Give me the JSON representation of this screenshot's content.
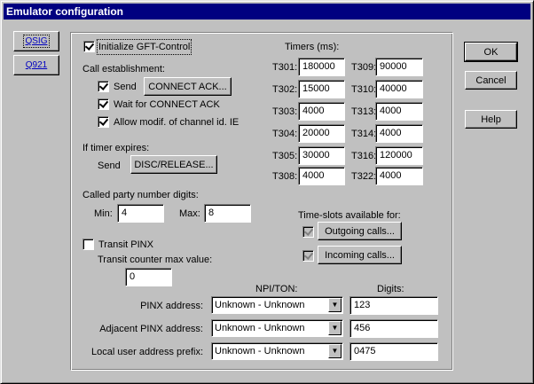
{
  "window": {
    "title": "Emulator configuration"
  },
  "tabs": [
    {
      "label": "QSIG"
    },
    {
      "label": "Q921"
    }
  ],
  "dialog_buttons": {
    "ok": "OK",
    "cancel": "Cancel",
    "help": "Help"
  },
  "init": {
    "label": "Initialize GFT-Control",
    "checked": true
  },
  "call_establishment": {
    "heading": "Call establishment:",
    "send_label": "Send",
    "send_checked": true,
    "connect_ack_button": "CONNECT ACK...",
    "wait_label": "Wait for CONNECT ACK",
    "wait_checked": true,
    "allow_label": "Allow modif. of channel id. IE",
    "allow_checked": true
  },
  "timer_expire": {
    "heading": "If timer expires:",
    "send_label": "Send",
    "disc_button": "DISC/RELEASE..."
  },
  "called_party": {
    "heading": "Called party number digits:",
    "min_label": "Min:",
    "min_value": "4",
    "max_label": "Max:",
    "max_value": "8"
  },
  "transit": {
    "label": "Transit PINX",
    "checked": false,
    "counter_label": "Transit counter max value:",
    "counter_value": "0"
  },
  "timers": {
    "heading": "Timers (ms):",
    "left": [
      {
        "name": "T301:",
        "value": "180000"
      },
      {
        "name": "T302:",
        "value": "15000"
      },
      {
        "name": "T303:",
        "value": "4000"
      },
      {
        "name": "T304:",
        "value": "20000"
      },
      {
        "name": "T305:",
        "value": "30000"
      },
      {
        "name": "T308:",
        "value": "4000"
      }
    ],
    "right": [
      {
        "name": "T309:",
        "value": "90000"
      },
      {
        "name": "T310:",
        "value": "40000"
      },
      {
        "name": "T313:",
        "value": "4000"
      },
      {
        "name": "T314:",
        "value": "4000"
      },
      {
        "name": "T316:",
        "value": "120000"
      },
      {
        "name": "T322:",
        "value": "4000"
      }
    ]
  },
  "timeslots": {
    "heading": "Time-slots available for:",
    "outgoing_button": "Outgoing calls...",
    "outgoing_checked": true,
    "incoming_button": "Incoming calls...",
    "incoming_checked": true
  },
  "addresses": {
    "npi_heading": "NPI/TON:",
    "digits_heading": "Digits:",
    "rows": [
      {
        "label": "PINX address:",
        "npi": "Unknown - Unknown",
        "digits": "123"
      },
      {
        "label": "Adjacent PINX address:",
        "npi": "Unknown - Unknown",
        "digits": "456"
      },
      {
        "label": "Local user address prefix:",
        "npi": "Unknown - Unknown",
        "digits": "0475"
      }
    ]
  },
  "icons": {
    "combo_arrow": "▼"
  }
}
